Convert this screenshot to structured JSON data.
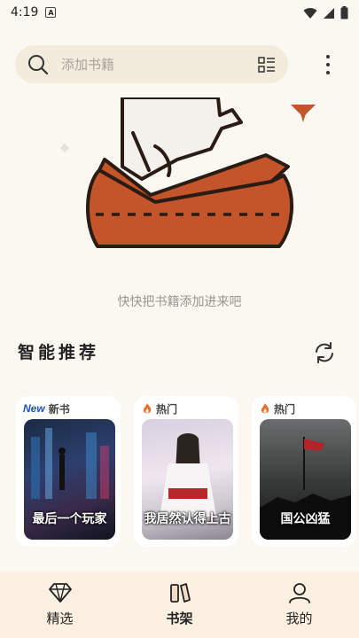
{
  "status_bar": {
    "time": "4:19",
    "notif_letter": "A"
  },
  "search": {
    "placeholder": "添加书籍"
  },
  "empty_state": {
    "text": "快快把书籍添加进来吧"
  },
  "recommend": {
    "title": "智能推荐",
    "cards": [
      {
        "tag_badge": "New",
        "tag": "新书",
        "cover_title": "最后一个玩家"
      },
      {
        "tag": "热门",
        "cover_title": "我居然认得上古"
      },
      {
        "tag": "热门",
        "cover_title": "国公凶猛"
      }
    ]
  },
  "nav": {
    "items": [
      {
        "label": "精选",
        "icon": "diamond-icon"
      },
      {
        "label": "书架",
        "icon": "bookshelf-icon"
      },
      {
        "label": "我的",
        "icon": "user-icon"
      }
    ],
    "active": "书架"
  },
  "colors": {
    "accent": "#c4552a",
    "background": "#fbf8f2",
    "nav_background": "#fbf0e2"
  }
}
